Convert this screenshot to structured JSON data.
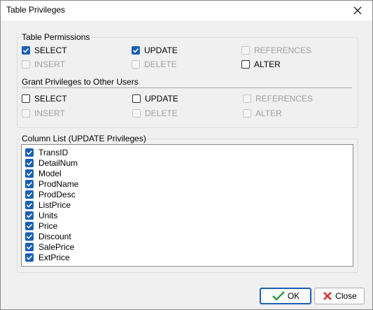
{
  "window": {
    "title": "Table Privileges"
  },
  "table_permissions": {
    "label": "Table Permissions",
    "items": [
      {
        "label": "SELECT",
        "checked": true,
        "enabled": true
      },
      {
        "label": "UPDATE",
        "checked": true,
        "enabled": true
      },
      {
        "label": "REFERENCES",
        "checked": false,
        "enabled": false
      },
      {
        "label": "INSERT",
        "checked": false,
        "enabled": false
      },
      {
        "label": "DELETE",
        "checked": false,
        "enabled": false
      },
      {
        "label": "ALTER",
        "checked": false,
        "enabled": true
      }
    ]
  },
  "grant_privileges": {
    "label": "Grant Privileges to Other Users",
    "items": [
      {
        "label": "SELECT",
        "checked": false,
        "enabled": true
      },
      {
        "label": "UPDATE",
        "checked": false,
        "enabled": true
      },
      {
        "label": "REFERENCES",
        "checked": false,
        "enabled": false
      },
      {
        "label": "INSERT",
        "checked": false,
        "enabled": false
      },
      {
        "label": "DELETE",
        "checked": false,
        "enabled": false
      },
      {
        "label": "ALTER",
        "checked": false,
        "enabled": false
      }
    ]
  },
  "column_list": {
    "label": "Column List (UPDATE Privileges)",
    "items": [
      {
        "label": "TransID",
        "checked": true
      },
      {
        "label": "DetailNum",
        "checked": true
      },
      {
        "label": "Model",
        "checked": true
      },
      {
        "label": "ProdName",
        "checked": true
      },
      {
        "label": "ProdDesc",
        "checked": true
      },
      {
        "label": "ListPrice",
        "checked": true
      },
      {
        "label": "Units",
        "checked": true
      },
      {
        "label": "Price",
        "checked": true
      },
      {
        "label": "Discount",
        "checked": true
      },
      {
        "label": "SalePrice",
        "checked": true
      },
      {
        "label": "ExtPrice",
        "checked": true
      }
    ]
  },
  "buttons": {
    "ok": "OK",
    "close": "Close"
  },
  "colors": {
    "accent": "#1a5fb4",
    "ok_check": "#2e9e3a",
    "close_x": "#d32f2f"
  },
  "icons": {
    "ok": "check-icon",
    "close": "x-icon",
    "window_close": "close-icon"
  }
}
